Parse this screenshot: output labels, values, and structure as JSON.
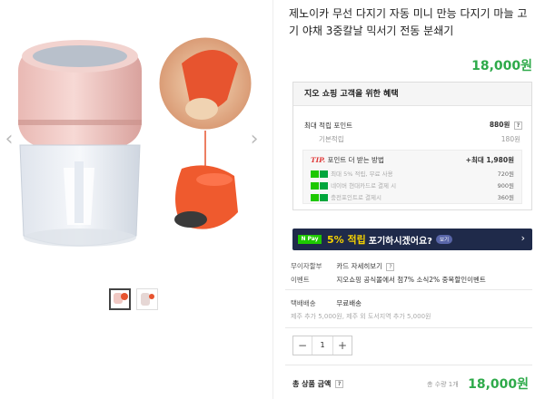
{
  "product": {
    "title": "제노이카 무선 다지기 자동 미니 만능 다지기 마늘 고기 야채 3중칼날 믹서기 전동 분쇄기",
    "price": "18,000원"
  },
  "gallery": {
    "prev_arrow": "‹",
    "next_arrow": "›",
    "thumbnails": [
      {
        "label": "thumb-1",
        "active": true
      },
      {
        "label": "thumb-2",
        "active": false
      }
    ]
  },
  "benefits": {
    "header": "지오 쇼핑 고객을 위한 혜택",
    "max_points_label": "최대 적립 포인트",
    "max_points_value": "880원",
    "basic_label": "기본적립",
    "basic_value": "180원",
    "tip_label": "TIP.",
    "tip_title": "포인트 더 받는 방법",
    "tip_max": "+최대 1,980원",
    "tip_items": [
      {
        "text": "최대 5% 적립, 무료 사용",
        "value": "720원"
      },
      {
        "text": "네이버 현대카드로 결제 시",
        "value": "900원"
      },
      {
        "text": "충전포인트로 결제시",
        "value": "360원"
      }
    ],
    "q_mark": "?"
  },
  "banner": {
    "npay": "N Pay",
    "percent": "5% 적립",
    "text": "포기하시겠어요?",
    "pill": "보기",
    "chevron": "›"
  },
  "info": {
    "interest_free": "무이자할부",
    "card_benefit": "카드 자세히보기",
    "event_label": "이벤트",
    "event_text": "지오쇼핑 공식몰에서 첨7% 소식2% 중복할인이벤트",
    "shipping_label": "택배배송",
    "shipping_value": "무료배송",
    "shipping_note": "제주 추가 5,000원, 제주 외 도서지역 추가 5,000원"
  },
  "quantity": {
    "minus": "−",
    "value": "1",
    "plus": "+"
  },
  "total": {
    "label": "총 상품 금액",
    "q_mark": "?",
    "count": "총 수량 1개",
    "price": "18,000원"
  },
  "colors": {
    "accent_green": "#2eaa4a",
    "banner_navy": "#1f2a4a",
    "npay_green": "#1ec800",
    "tip_red": "#e03a3a"
  }
}
